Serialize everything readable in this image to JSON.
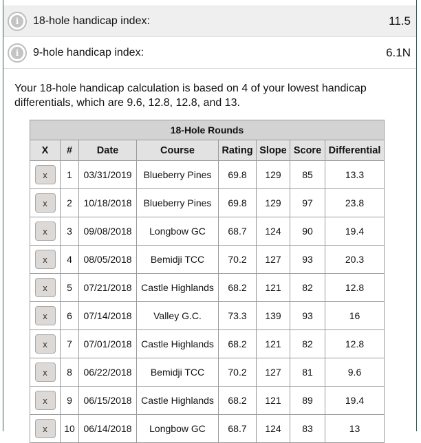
{
  "handicap": {
    "rows": [
      {
        "label": "18-hole handicap index:",
        "value": "11.5",
        "icon": "info-icon"
      },
      {
        "label": "9-hole handicap index:",
        "value": "6.1N",
        "icon": "info-icon"
      }
    ]
  },
  "explanation": "Your 18-hole handicap calculation is based on 4 of your lowest handicap differentials, which are 9.6, 12.8, 12.8, and 13.",
  "table": {
    "title": "18-Hole Rounds",
    "columns": [
      "X",
      "#",
      "Date",
      "Course",
      "Rating",
      "Slope",
      "Score",
      "Differential"
    ],
    "delete_label": "x",
    "rows": [
      {
        "num": "1",
        "date": "03/31/2019",
        "course": "Blueberry Pines",
        "rating": "69.8",
        "slope": "129",
        "score": "85",
        "differential": "13.3"
      },
      {
        "num": "2",
        "date": "10/18/2018",
        "course": "Blueberry Pines",
        "rating": "69.8",
        "slope": "129",
        "score": "97",
        "differential": "23.8"
      },
      {
        "num": "3",
        "date": "09/08/2018",
        "course": "Longbow GC",
        "rating": "68.7",
        "slope": "124",
        "score": "90",
        "differential": "19.4"
      },
      {
        "num": "4",
        "date": "08/05/2018",
        "course": "Bemidji TCC",
        "rating": "70.2",
        "slope": "127",
        "score": "93",
        "differential": "20.3"
      },
      {
        "num": "5",
        "date": "07/21/2018",
        "course": "Castle Highlands",
        "rating": "68.2",
        "slope": "121",
        "score": "82",
        "differential": "12.8"
      },
      {
        "num": "6",
        "date": "07/14/2018",
        "course": "Valley G.C.",
        "rating": "73.3",
        "slope": "139",
        "score": "93",
        "differential": "16"
      },
      {
        "num": "7",
        "date": "07/01/2018",
        "course": "Castle Highlands",
        "rating": "68.2",
        "slope": "121",
        "score": "82",
        "differential": "12.8"
      },
      {
        "num": "8",
        "date": "06/22/2018",
        "course": "Bemidji TCC",
        "rating": "70.2",
        "slope": "127",
        "score": "81",
        "differential": "9.6"
      },
      {
        "num": "9",
        "date": "06/15/2018",
        "course": "Castle Highlands",
        "rating": "68.2",
        "slope": "121",
        "score": "89",
        "differential": "19.4"
      },
      {
        "num": "10",
        "date": "06/14/2018",
        "course": "Longbow GC",
        "rating": "68.7",
        "slope": "124",
        "score": "83",
        "differential": "13"
      }
    ]
  }
}
